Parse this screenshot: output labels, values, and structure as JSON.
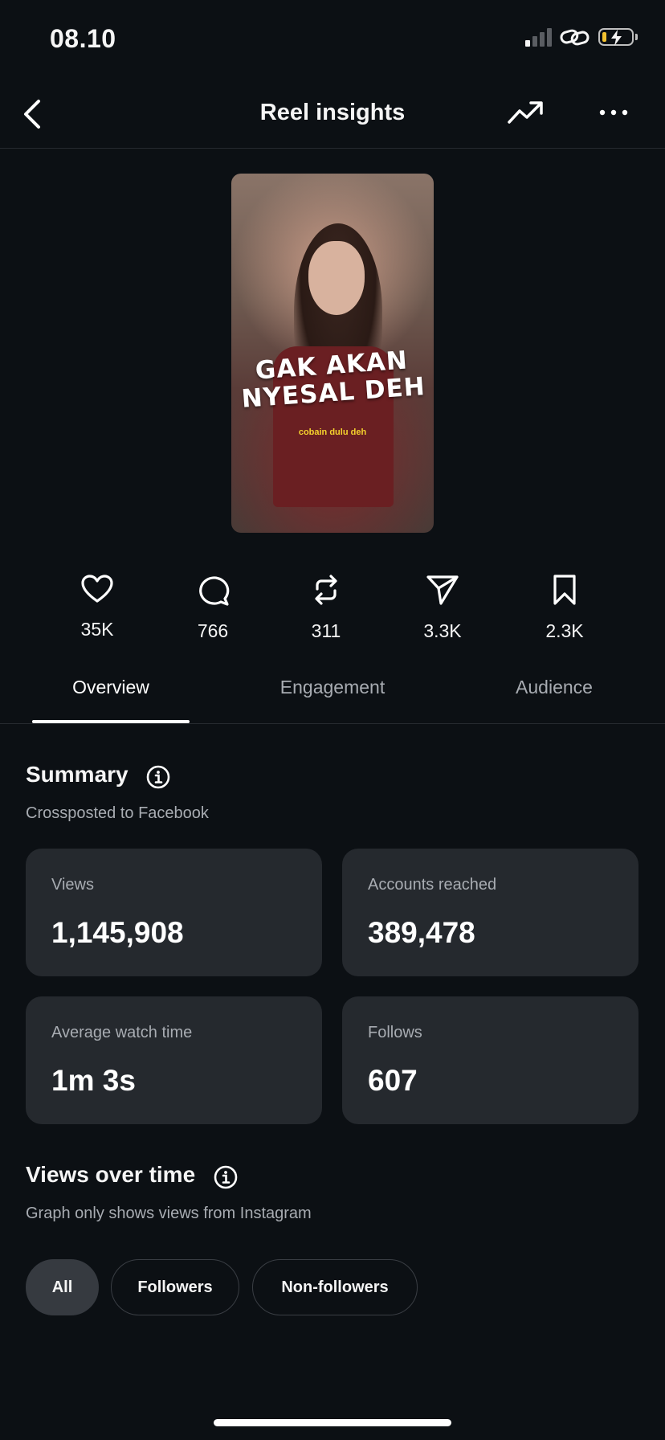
{
  "status_bar": {
    "time": "08.10"
  },
  "header": {
    "title": "Reel insights"
  },
  "reel": {
    "thumbnail_text_line1": "GAK AKAN",
    "thumbnail_text_line2": "NYESAL DEH",
    "thumbnail_subtext": "cobain dulu deh"
  },
  "stats": [
    {
      "icon": "heart-icon",
      "value": "35K"
    },
    {
      "icon": "comment-icon",
      "value": "766"
    },
    {
      "icon": "repost-icon",
      "value": "311"
    },
    {
      "icon": "share-icon",
      "value": "3.3K"
    },
    {
      "icon": "bookmark-icon",
      "value": "2.3K"
    }
  ],
  "tabs": [
    {
      "label": "Overview",
      "active": true
    },
    {
      "label": "Engagement",
      "active": false
    },
    {
      "label": "Audience",
      "active": false
    }
  ],
  "summary": {
    "title": "Summary",
    "subtitle": "Crossposted to Facebook",
    "cards": [
      {
        "label": "Views",
        "value": "1,145,908"
      },
      {
        "label": "Accounts reached",
        "value": "389,478"
      },
      {
        "label": "Average watch time",
        "value": "1m 3s"
      },
      {
        "label": "Follows",
        "value": "607"
      }
    ]
  },
  "views_over_time": {
    "title": "Views over time",
    "subtitle": "Graph only shows views from Instagram",
    "filters": [
      {
        "label": "All",
        "active": true
      },
      {
        "label": "Followers",
        "active": false
      },
      {
        "label": "Non-followers",
        "active": false
      }
    ]
  },
  "colors": {
    "background": "#0c1014",
    "card": "#25292e",
    "secondary_text": "#a8acb2",
    "battery_low": "#f2c230"
  }
}
